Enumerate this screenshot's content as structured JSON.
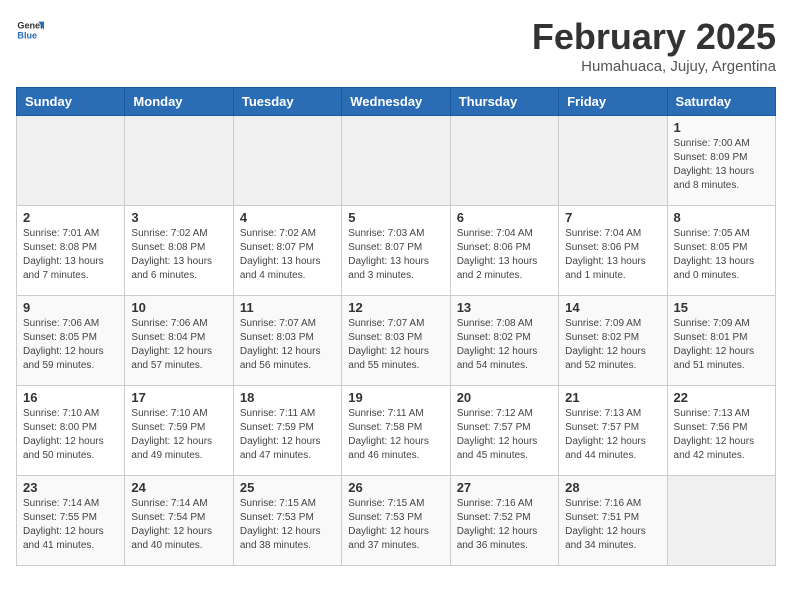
{
  "logo": {
    "text_general": "General",
    "text_blue": "Blue"
  },
  "header": {
    "title": "February 2025",
    "subtitle": "Humahuaca, Jujuy, Argentina"
  },
  "weekdays": [
    "Sunday",
    "Monday",
    "Tuesday",
    "Wednesday",
    "Thursday",
    "Friday",
    "Saturday"
  ],
  "weeks": [
    [
      {
        "day": "",
        "empty": true
      },
      {
        "day": "",
        "empty": true
      },
      {
        "day": "",
        "empty": true
      },
      {
        "day": "",
        "empty": true
      },
      {
        "day": "",
        "empty": true
      },
      {
        "day": "",
        "empty": true
      },
      {
        "day": "1",
        "sunrise": "7:00 AM",
        "sunset": "8:09 PM",
        "daylight": "13 hours and 8 minutes."
      }
    ],
    [
      {
        "day": "2",
        "sunrise": "7:01 AM",
        "sunset": "8:08 PM",
        "daylight": "13 hours and 7 minutes."
      },
      {
        "day": "3",
        "sunrise": "7:02 AM",
        "sunset": "8:08 PM",
        "daylight": "13 hours and 6 minutes."
      },
      {
        "day": "4",
        "sunrise": "7:02 AM",
        "sunset": "8:07 PM",
        "daylight": "13 hours and 4 minutes."
      },
      {
        "day": "5",
        "sunrise": "7:03 AM",
        "sunset": "8:07 PM",
        "daylight": "13 hours and 3 minutes."
      },
      {
        "day": "6",
        "sunrise": "7:04 AM",
        "sunset": "8:06 PM",
        "daylight": "13 hours and 2 minutes."
      },
      {
        "day": "7",
        "sunrise": "7:04 AM",
        "sunset": "8:06 PM",
        "daylight": "13 hours and 1 minute."
      },
      {
        "day": "8",
        "sunrise": "7:05 AM",
        "sunset": "8:05 PM",
        "daylight": "13 hours and 0 minutes."
      }
    ],
    [
      {
        "day": "9",
        "sunrise": "7:06 AM",
        "sunset": "8:05 PM",
        "daylight": "12 hours and 59 minutes."
      },
      {
        "day": "10",
        "sunrise": "7:06 AM",
        "sunset": "8:04 PM",
        "daylight": "12 hours and 57 minutes."
      },
      {
        "day": "11",
        "sunrise": "7:07 AM",
        "sunset": "8:03 PM",
        "daylight": "12 hours and 56 minutes."
      },
      {
        "day": "12",
        "sunrise": "7:07 AM",
        "sunset": "8:03 PM",
        "daylight": "12 hours and 55 minutes."
      },
      {
        "day": "13",
        "sunrise": "7:08 AM",
        "sunset": "8:02 PM",
        "daylight": "12 hours and 54 minutes."
      },
      {
        "day": "14",
        "sunrise": "7:09 AM",
        "sunset": "8:02 PM",
        "daylight": "12 hours and 52 minutes."
      },
      {
        "day": "15",
        "sunrise": "7:09 AM",
        "sunset": "8:01 PM",
        "daylight": "12 hours and 51 minutes."
      }
    ],
    [
      {
        "day": "16",
        "sunrise": "7:10 AM",
        "sunset": "8:00 PM",
        "daylight": "12 hours and 50 minutes."
      },
      {
        "day": "17",
        "sunrise": "7:10 AM",
        "sunset": "7:59 PM",
        "daylight": "12 hours and 49 minutes."
      },
      {
        "day": "18",
        "sunrise": "7:11 AM",
        "sunset": "7:59 PM",
        "daylight": "12 hours and 47 minutes."
      },
      {
        "day": "19",
        "sunrise": "7:11 AM",
        "sunset": "7:58 PM",
        "daylight": "12 hours and 46 minutes."
      },
      {
        "day": "20",
        "sunrise": "7:12 AM",
        "sunset": "7:57 PM",
        "daylight": "12 hours and 45 minutes."
      },
      {
        "day": "21",
        "sunrise": "7:13 AM",
        "sunset": "7:57 PM",
        "daylight": "12 hours and 44 minutes."
      },
      {
        "day": "22",
        "sunrise": "7:13 AM",
        "sunset": "7:56 PM",
        "daylight": "12 hours and 42 minutes."
      }
    ],
    [
      {
        "day": "23",
        "sunrise": "7:14 AM",
        "sunset": "7:55 PM",
        "daylight": "12 hours and 41 minutes."
      },
      {
        "day": "24",
        "sunrise": "7:14 AM",
        "sunset": "7:54 PM",
        "daylight": "12 hours and 40 minutes."
      },
      {
        "day": "25",
        "sunrise": "7:15 AM",
        "sunset": "7:53 PM",
        "daylight": "12 hours and 38 minutes."
      },
      {
        "day": "26",
        "sunrise": "7:15 AM",
        "sunset": "7:53 PM",
        "daylight": "12 hours and 37 minutes."
      },
      {
        "day": "27",
        "sunrise": "7:16 AM",
        "sunset": "7:52 PM",
        "daylight": "12 hours and 36 minutes."
      },
      {
        "day": "28",
        "sunrise": "7:16 AM",
        "sunset": "7:51 PM",
        "daylight": "12 hours and 34 minutes."
      },
      {
        "day": "",
        "empty": true
      }
    ]
  ]
}
